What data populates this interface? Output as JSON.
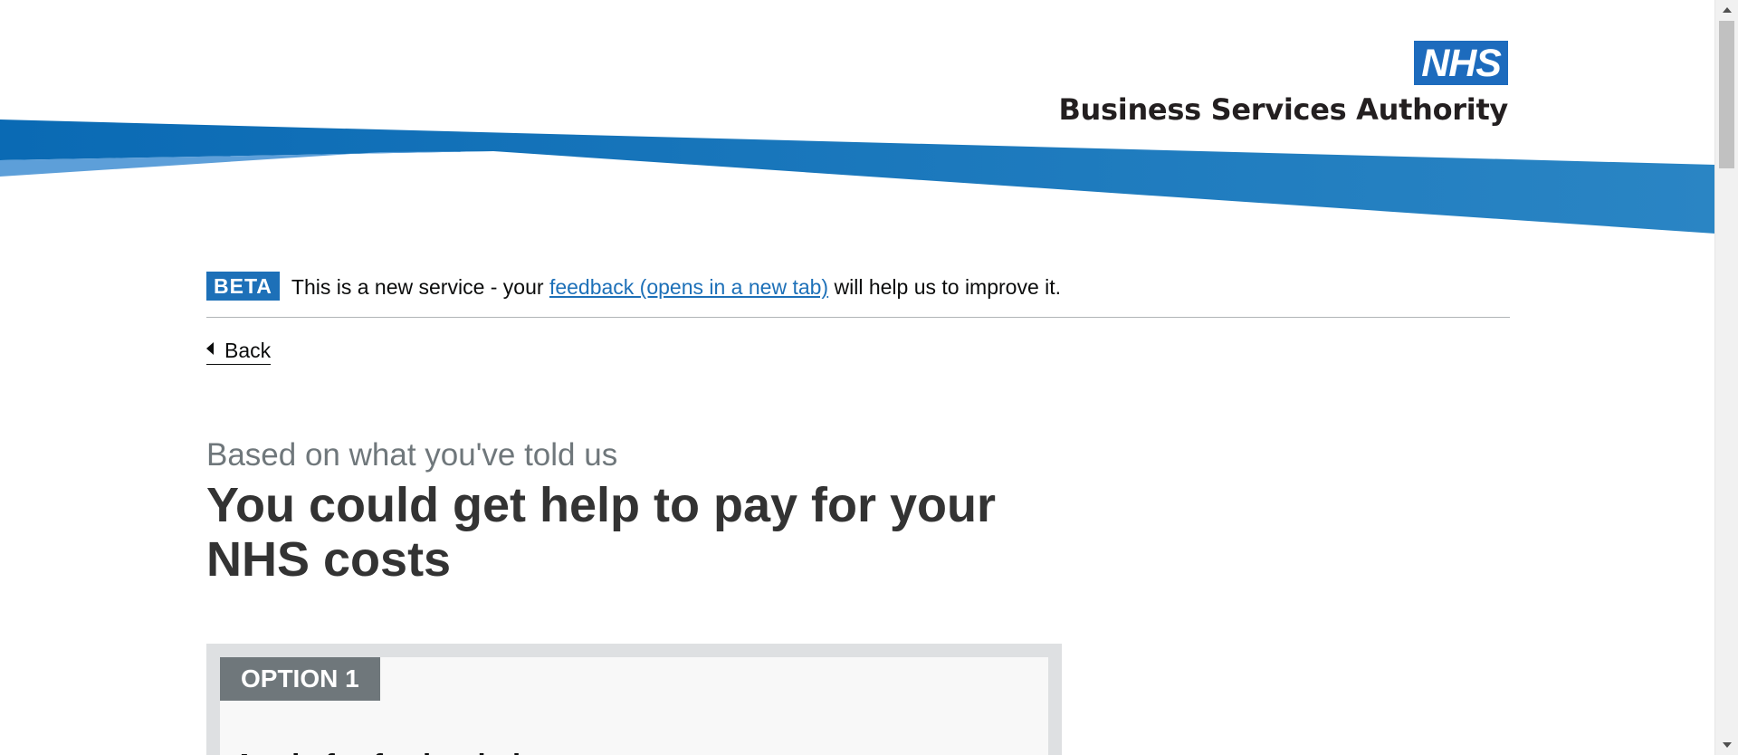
{
  "header": {
    "logo_badge": "NHS",
    "logo_org": "Business Services Authority",
    "colors": {
      "swoosh_dark": "#0c6db3",
      "swoosh_light": "#5a9fd8",
      "badge": "#1d6bbd"
    }
  },
  "beta_banner": {
    "tag": "BETA",
    "text_before": "This is a new service - your ",
    "link": "feedback (opens in a new tab)",
    "text_after": " will help us to improve it."
  },
  "back_link": {
    "label": "Back",
    "icon": "chevron-left-icon"
  },
  "main": {
    "caption": "Based on what you've told us",
    "heading": "You could get help to pay for your NHS costs"
  },
  "option_1": {
    "tag": "OPTION 1",
    "title": "Apply for further help"
  },
  "scrollbar": {
    "up_icon": "scroll-up-arrow-icon",
    "down_icon": "scroll-down-arrow-icon"
  }
}
